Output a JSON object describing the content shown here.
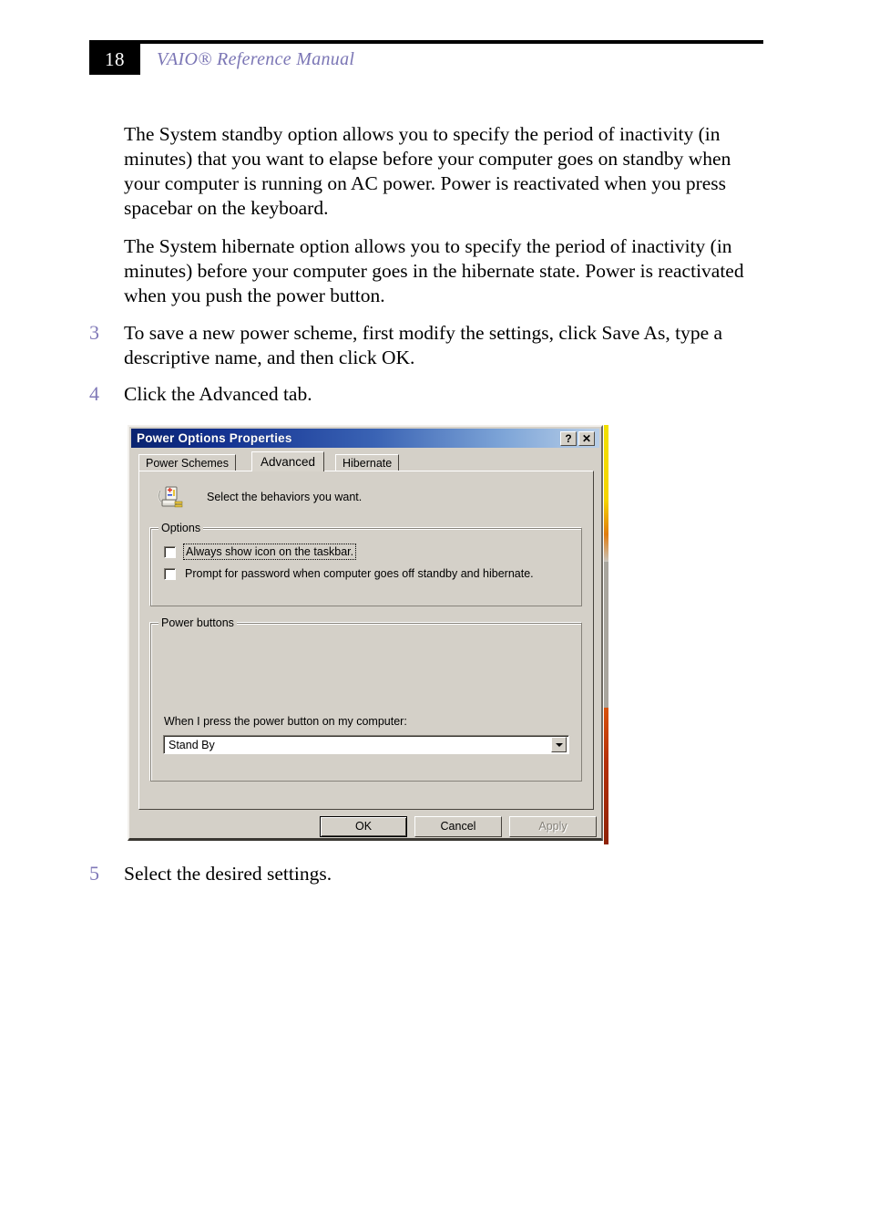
{
  "page": {
    "number": "18",
    "header_title": "VAIO® Reference Manual",
    "header_accent_color": "#7b76b5",
    "step_number_color": "#8079b8"
  },
  "body": {
    "paragraph_standby": "The System standby option allows you to specify the period of inactivity (in minutes) that you want to elapse before your computer goes on standby when your computer is running on AC power. Power is reactivated when you press spacebar on the keyboard.",
    "paragraph_hibernate": "The System hibernate option allows you to specify the period of inactivity (in minutes) before your computer goes in the hibernate state. Power is reactivated when you push the power button.",
    "steps": [
      {
        "number": "3",
        "text": "To save a new power scheme, first modify the settings, click Save As, type a descriptive name, and then click OK."
      },
      {
        "number": "4",
        "text": "Click the Advanced tab."
      },
      {
        "number": "5",
        "text": "Select the desired settings."
      }
    ]
  },
  "dialog": {
    "title": "Power Options Properties",
    "titlebar_gradient_start": "#0a2470",
    "titlebar_gradient_end": "#b9cfe8",
    "face_color": "#d4d0c8",
    "help_button_label": "?",
    "close_button_label": "✕",
    "tabs": [
      {
        "label": "Power Schemes",
        "selected": false
      },
      {
        "label": "Advanced",
        "selected": true
      },
      {
        "label": "Hibernate",
        "selected": false
      }
    ],
    "banner_text": "Select the behaviors you want.",
    "banner_icon": "battery-power-plug-icon",
    "groups": {
      "options": {
        "title": "Options",
        "checkboxes": [
          {
            "label": "Always show icon on the taskbar.",
            "checked": false,
            "focused": true
          },
          {
            "label": "Prompt for password when computer goes off standby and hibernate.",
            "checked": false,
            "focused": false
          }
        ]
      },
      "power_buttons": {
        "title": "Power buttons",
        "combo_label": "When I press the power button on my computer:",
        "combo_value": "Stand By"
      }
    },
    "buttons": [
      {
        "label": "OK",
        "state": "default"
      },
      {
        "label": "Cancel",
        "state": "normal"
      },
      {
        "label": "Apply",
        "state": "disabled"
      }
    ]
  }
}
